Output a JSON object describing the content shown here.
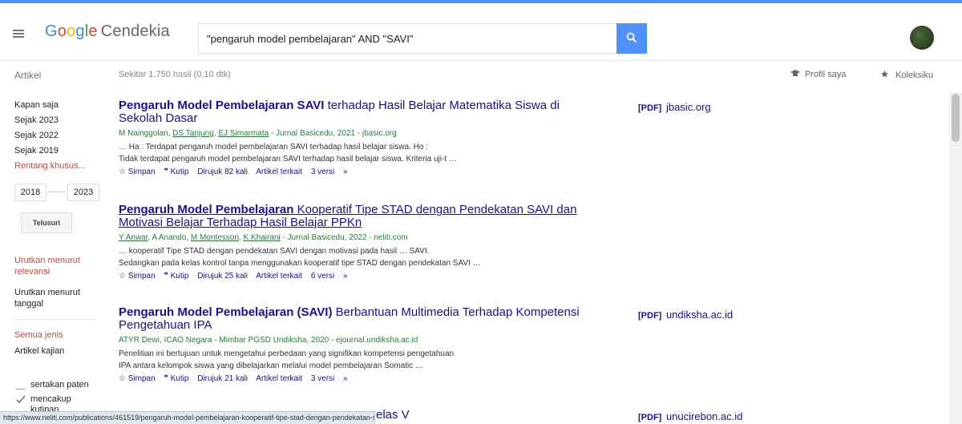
{
  "header": {
    "logo_letters": [
      "G",
      "o",
      "o",
      "g",
      "l",
      "e"
    ],
    "logo_product": "Cendekia",
    "search_value": "\"pengaruh model pembelajaran\" AND \"SAVI\"",
    "avatar": "user-avatar"
  },
  "subbar": {
    "artikel_label": "Artikel",
    "result_count": "Sekitar 1.750 hasil (0,10 dtk)",
    "profile_label": "Profil saya",
    "library_label": "Koleksiku"
  },
  "sidebar": {
    "time_filters": [
      "Kapan saja",
      "Sejak 2023",
      "Sejak 2022",
      "Sejak 2019",
      "Rentang khusus..."
    ],
    "year_from": "2018",
    "year_to": "2023",
    "search_button": "Telusuri",
    "sort_relevance": "Urutkan menurut relevansi",
    "sort_date": "Urutkan menurut tanggal",
    "type_all": "Semua jenis",
    "type_review": "Artikel kajian",
    "include_patents": "sertakan paten",
    "include_citations": "mencakup kutipan"
  },
  "results": [
    {
      "title_bold": "Pengaruh Model Pembelajaran SAVI",
      "title_rest": " terhadap Hasil Belajar Matematika Siswa di Sekolah Dasar",
      "authors_plain_1": "M Nainggolan, ",
      "author_link_1": "DS Tanjung",
      "authors_sep": ", ",
      "author_link_2": "EJ Simarmata",
      "meta_rest": " - Jurnal Basicedu, 2021 - jbasic.org",
      "snippet_1": "… Ha : Terdapat pengaruh model pembelajaran SAVI terhadap hasil belajar siswa. Ho :",
      "snippet_2": "Tidak terdapat pengaruh model pembelajaran SAVI terhadap hasil belajar siswa. Kriteria uji-t …",
      "save": "Simpan",
      "cite": "Kutip",
      "cited_by": "Dirujuk 82 kali",
      "related": "Artikel terkait",
      "versions": "3 versi",
      "side_pdf": "[PDF]",
      "side_domain": "jbasic.org"
    },
    {
      "title_bold": "Pengaruh Model Pembelajaran",
      "title_rest": " Kooperatif Tipe STAD dengan Pendekatan SAVI dan Motivasi Belajar Terhadap Hasil Belajar PPKn",
      "authors_plain_1": "",
      "author_link_1": "Y Anwar",
      "authors_sep": ", A Anando, ",
      "author_link_2": "M Montessori",
      "authors_sep_2": ", ",
      "author_link_3": "K Khairani",
      "meta_rest": " - Jurnal Basicedu, 2022 - neliti.com",
      "snippet_1": "… kooperatif Tipe STAD dengan pendekatan SAVI dengan motivasi pada hasil … SAVI.",
      "snippet_2": "Sedangkan pada kelas kontrol tanpa menggunakan kooperatif tipe STAD dengan pendekatan SAVI …",
      "save": "Simpan",
      "cite": "Kutip",
      "cited_by": "Dirujuk 25 kali",
      "related": "Artikel terkait",
      "versions": "6 versi"
    },
    {
      "title_bold": "Pengaruh Model Pembelajaran (SAVI)",
      "title_rest": " Berbantuan Multimedia Terhadap Kompetensi Pengetahuan IPA",
      "meta": "ATYR Dewi, ICAO Negara - Mimbar PGSD Undiksha, 2020 - ejournal.undiksha.ac.id",
      "snippet_1": "Penelitian ini bertujuan untuk mengetahui perbedaan yang signifikan kompetensi pengetahuan",
      "snippet_2": "IPA antara kelompok siswa yang dibelajarkan melalui model pembelajaran Somatic …",
      "save": "Simpan",
      "cite": "Kutip",
      "cited_by": "Dirujuk 21 kali",
      "related": "Artikel terkait",
      "versions": "3 versi",
      "side_pdf": "[PDF]",
      "side_domain": "undiksha.ac.id"
    },
    {
      "title_tail": "elas V",
      "side_pdf": "[PDF]",
      "side_domain": "unucirebon.ac.id"
    }
  ],
  "statusbar": {
    "url": "https://www.neliti.com/publications/461519/pengaruh-model-pembelajaran-kooperatif-tipe-stad-dengan-pendekatan-savi-dan-motivasi-belajar"
  },
  "colors": {
    "link_blue": "#1a0dab",
    "meta_green": "#2a7e3c",
    "accent_red": "#d14836",
    "search_blue": "#4d90fe"
  }
}
